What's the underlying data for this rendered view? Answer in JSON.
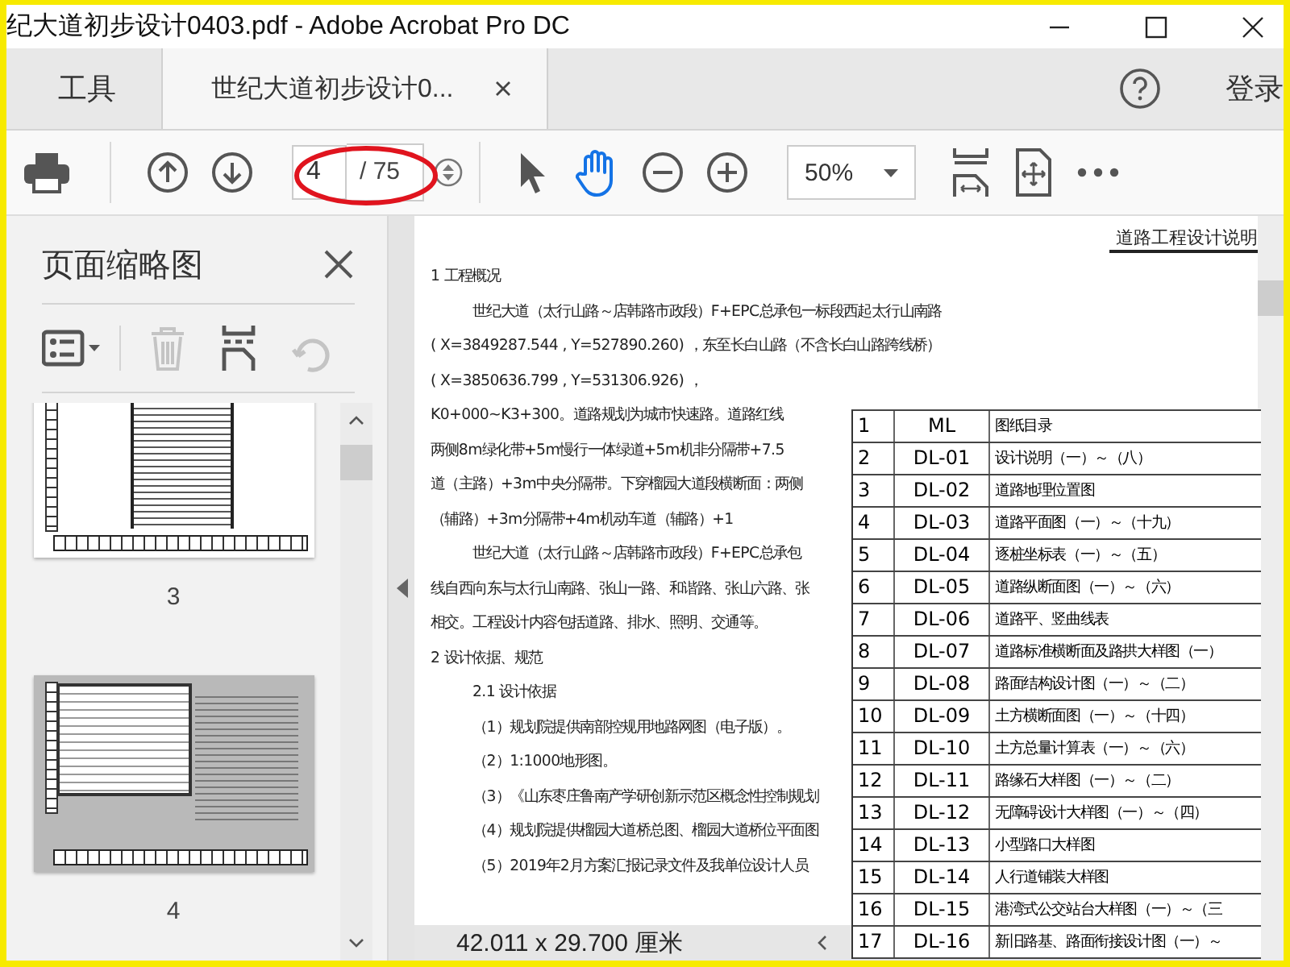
{
  "window": {
    "title": "纪大道初步设计0403.pdf - Adobe Acrobat Pro DC"
  },
  "tabs": [
    {
      "label": "工具",
      "selected": false,
      "closable": false
    },
    {
      "label": "世纪大道初步设计0...",
      "selected": true,
      "closable": true
    }
  ],
  "sign_in": "登录",
  "toolbar": {
    "page_field": {
      "value": "4"
    },
    "page_total": "/ 75",
    "tools": [
      {
        "kind": "select",
        "selected": false
      },
      {
        "kind": "hand",
        "selected": true
      }
    ],
    "zoom": "50%"
  },
  "sidebar": {
    "title": "页面缩略图",
    "tools": [
      {
        "kind": "options",
        "disabled": false
      },
      {
        "kind": "delete",
        "disabled": true
      },
      {
        "kind": "insert",
        "disabled": false
      },
      {
        "kind": "rotate",
        "disabled": true
      }
    ],
    "thumbnails": [
      {
        "label": "3",
        "selected": false
      },
      {
        "label": "4",
        "selected": true
      }
    ]
  },
  "document": {
    "header": "道路工程设计说明",
    "lines": [
      {
        "kind": "heading",
        "text": "1  工程概况"
      },
      {
        "kind": "para",
        "text": "世纪大道（太行山路～店韩路市政段）F+EPC总承包一标段西起太行山南路"
      },
      {
        "kind": "plain",
        "text": "( X=3849287.544 , Y=527890.260) ，东至长白山路（不含长白山路跨线桥）"
      },
      {
        "kind": "plain",
        "text": "( X=3850636.799 , Y=531306.926) ，"
      },
      {
        "kind": "plain",
        "text": "K0+000~K3+300。道路规划为城市快速路。道路红线"
      },
      {
        "kind": "plain",
        "text": "两侧8m绿化带+5m慢行一体绿道+5m机非分隔带+7.5"
      },
      {
        "kind": "plain",
        "text": "道（主路）+3m中央分隔带。下穿榴园大道段横断面：两侧"
      },
      {
        "kind": "plain",
        "text": "（辅路）+3m分隔带+4m机动车道（辅路）+1"
      },
      {
        "kind": "para",
        "text": "世纪大道（太行山路～店韩路市政段）F+EPC总承包"
      },
      {
        "kind": "plain",
        "text": "线自西向东与太行山南路、张山一路、和谐路、张山六路、张"
      },
      {
        "kind": "plain",
        "text": "相交。工程设计内容包括道路、排水、照明、交通等。"
      },
      {
        "kind": "heading",
        "text": "2  设计依据、规范"
      },
      {
        "kind": "para",
        "text": "2.1  设计依据"
      },
      {
        "kind": "para",
        "text": "（1）规划院提供南部控规用地路网图（电子版）。"
      },
      {
        "kind": "para",
        "text": "（2）1:1000地形图。"
      },
      {
        "kind": "para",
        "text": "（3）《山东枣庄鲁南产学研创新示范区概念性控制规划"
      },
      {
        "kind": "para",
        "text": "（4）规划院提供榴园大道桥总图、榴园大道桥位平面图"
      },
      {
        "kind": "para",
        "text": "（5）2019年2月方案汇报记录文件及我单位设计人员"
      }
    ],
    "table": [
      {
        "no": "1",
        "code": "ML",
        "title": "图纸目录"
      },
      {
        "no": "2",
        "code": "DL-01",
        "title": "设计说明（一）～（八）"
      },
      {
        "no": "3",
        "code": "DL-02",
        "title": "道路地理位置图"
      },
      {
        "no": "4",
        "code": "DL-03",
        "title": "道路平面图（一）～（十九）"
      },
      {
        "no": "5",
        "code": "DL-04",
        "title": "逐桩坐标表（一）～（五）"
      },
      {
        "no": "6",
        "code": "DL-05",
        "title": "道路纵断面图（一）～（六）"
      },
      {
        "no": "7",
        "code": "DL-06",
        "title": "道路平、竖曲线表"
      },
      {
        "no": "8",
        "code": "DL-07",
        "title": "道路标准横断面及路拱大样图（一）"
      },
      {
        "no": "9",
        "code": "DL-08",
        "title": "路面结构设计图（一）～（二）"
      },
      {
        "no": "10",
        "code": "DL-09",
        "title": "土方横断面图（一）～（十四）"
      },
      {
        "no": "11",
        "code": "DL-10",
        "title": "土方总量计算表（一）～（六）"
      },
      {
        "no": "12",
        "code": "DL-11",
        "title": "路缘石大样图（一）～（二）"
      },
      {
        "no": "13",
        "code": "DL-12",
        "title": "无障碍设计大样图（一）～（四）"
      },
      {
        "no": "14",
        "code": "DL-13",
        "title": "小型路口大样图"
      },
      {
        "no": "15",
        "code": "DL-14",
        "title": "人行道铺装大样图"
      },
      {
        "no": "16",
        "code": "DL-15",
        "title": "港湾式公交站台大样图（一）～（三"
      },
      {
        "no": "17",
        "code": "DL-16",
        "title": "新旧路基、路面衔接设计图（一）～"
      }
    ]
  },
  "status_bar": {
    "page_size": "42.011 x 29.700 厘米"
  }
}
